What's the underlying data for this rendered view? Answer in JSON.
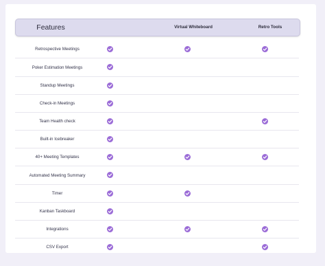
{
  "colors": {
    "accent": "#9b6cd7",
    "header_bg": "#dddbee",
    "page_bg": "#f1eff8"
  },
  "header": {
    "features": "Features",
    "virtual_whiteboard": "Virtual Whiteboard",
    "retro_tools": "Retro Tools"
  },
  "icon": "check-circle-icon",
  "rows": [
    {
      "label": "Retrospective Meetings",
      "features": true,
      "virtual_whiteboard": true,
      "retro_tools": true
    },
    {
      "label": "Poker Estimation Meetings",
      "features": true,
      "virtual_whiteboard": false,
      "retro_tools": false
    },
    {
      "label": "Standup Meetings",
      "features": true,
      "virtual_whiteboard": false,
      "retro_tools": false
    },
    {
      "label": "Check-in Meetings",
      "features": true,
      "virtual_whiteboard": false,
      "retro_tools": false
    },
    {
      "label": "Team Health check",
      "features": true,
      "virtual_whiteboard": false,
      "retro_tools": true
    },
    {
      "label": "Built-in Icebreaker",
      "features": true,
      "virtual_whiteboard": false,
      "retro_tools": false
    },
    {
      "label": "40+ Meeting Templates",
      "features": true,
      "virtual_whiteboard": true,
      "retro_tools": true
    },
    {
      "label": "Automated Meeting Summary",
      "features": true,
      "virtual_whiteboard": false,
      "retro_tools": false
    },
    {
      "label": "Timer",
      "features": true,
      "virtual_whiteboard": true,
      "retro_tools": false
    },
    {
      "label": "Kanban Taskboard",
      "features": true,
      "virtual_whiteboard": false,
      "retro_tools": false
    },
    {
      "label": "Integrations",
      "features": true,
      "virtual_whiteboard": true,
      "retro_tools": true
    },
    {
      "label": "CSV Export",
      "features": true,
      "virtual_whiteboard": false,
      "retro_tools": true
    }
  ]
}
